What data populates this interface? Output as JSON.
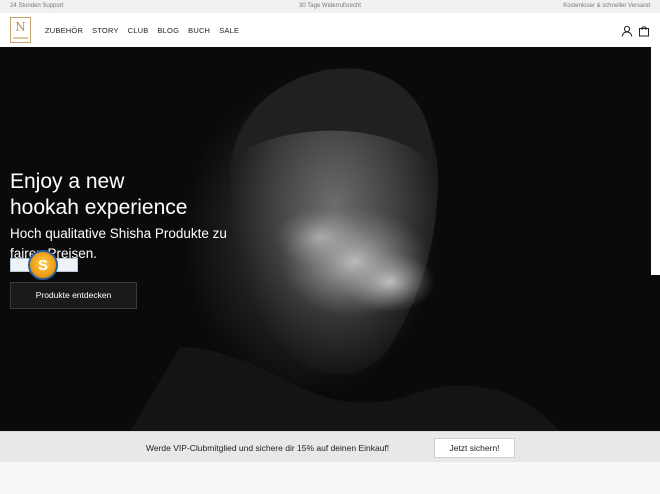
{
  "topbar": {
    "left": "24 Stunden Support",
    "center": "30 Tage Widerrufsrecht",
    "right": "Kostenloser & schneller Versand"
  },
  "header": {
    "logo_text": "N",
    "nav": [
      {
        "label": "ZUBEHÖR"
      },
      {
        "label": "STORY"
      },
      {
        "label": "CLUB"
      },
      {
        "label": "BLOG"
      },
      {
        "label": "BUCH"
      },
      {
        "label": "SALE"
      }
    ],
    "icons": [
      "user-icon",
      "cart-icon"
    ]
  },
  "hero": {
    "title_line1": "Enjoy a new",
    "title_line2": "hookah experience",
    "subtitle": "Hoch qualitative Shisha Produkte zu fairen Preisen.",
    "badge_letter": "S",
    "cta_label": "Produkte entdecken"
  },
  "promo": {
    "text": "Werde VIP-Clubmitglied und sichere dir 15% auf deinen Einkauf!",
    "button_label": "Jetzt sichern!"
  },
  "colors": {
    "gold": "#c4a26b",
    "dark": "#1a1a1a",
    "badge_blue": "#2c5f9e",
    "badge_orange": "#f0a21a"
  }
}
